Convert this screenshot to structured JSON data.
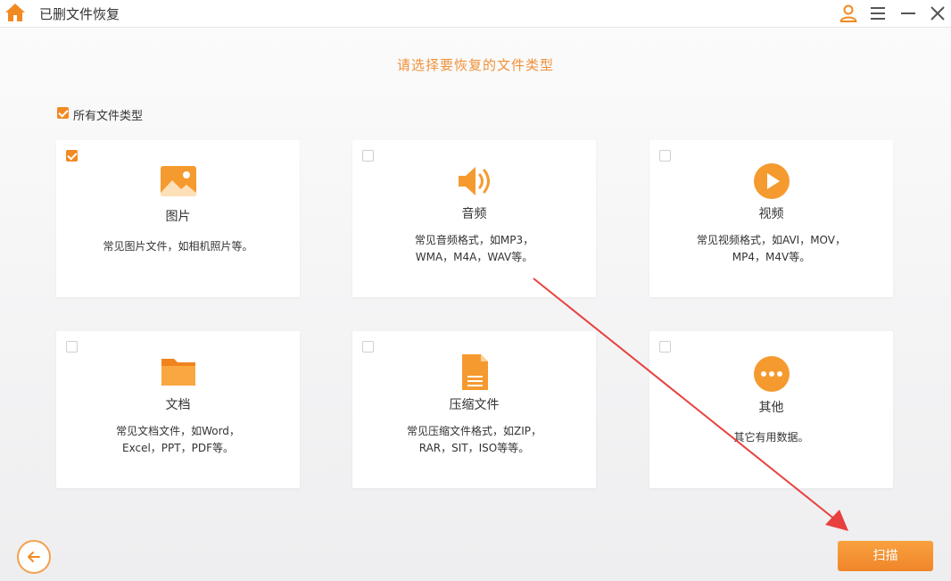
{
  "window": {
    "title": "已删文件恢复",
    "icons": [
      "home-icon",
      "user-icon",
      "menu-icon",
      "minimize-icon",
      "close-icon"
    ]
  },
  "prompt": "请选择要恢复的文件类型",
  "select_all": {
    "label": "所有文件类型",
    "checked": true
  },
  "cards": [
    {
      "title": "图片",
      "desc": [
        "常见图片文件，如相机照片等。"
      ],
      "checked": true,
      "icon": "image-icon"
    },
    {
      "title": "音频",
      "desc": [
        "常见音频格式，如MP3，",
        "WMA，M4A，WAV等。"
      ],
      "checked": false,
      "icon": "speaker-icon"
    },
    {
      "title": "视频",
      "desc": [
        "常见视频格式，如AVI，MOV，",
        "MP4，M4V等。"
      ],
      "checked": false,
      "icon": "play-icon"
    },
    {
      "title": "文档",
      "desc": [
        "常见文档文件，如Word，",
        "Excel，PPT，PDF等。"
      ],
      "checked": false,
      "icon": "folder-icon"
    },
    {
      "title": "压缩文件",
      "desc": [
        "常见压缩文件格式，如ZIP，",
        "RAR，SIT，ISO等等。"
      ],
      "checked": false,
      "icon": "archive-icon"
    },
    {
      "title": "其他",
      "desc": [
        "其它有用数据。"
      ],
      "checked": false,
      "icon": "more-icon"
    }
  ],
  "footer": {
    "scan_label": "扫描",
    "back_icon": "back-arrow-icon"
  },
  "colors": {
    "accent": "#f28a22",
    "prompt": "#f0913a",
    "annotation_arrow": "#e8403f"
  }
}
